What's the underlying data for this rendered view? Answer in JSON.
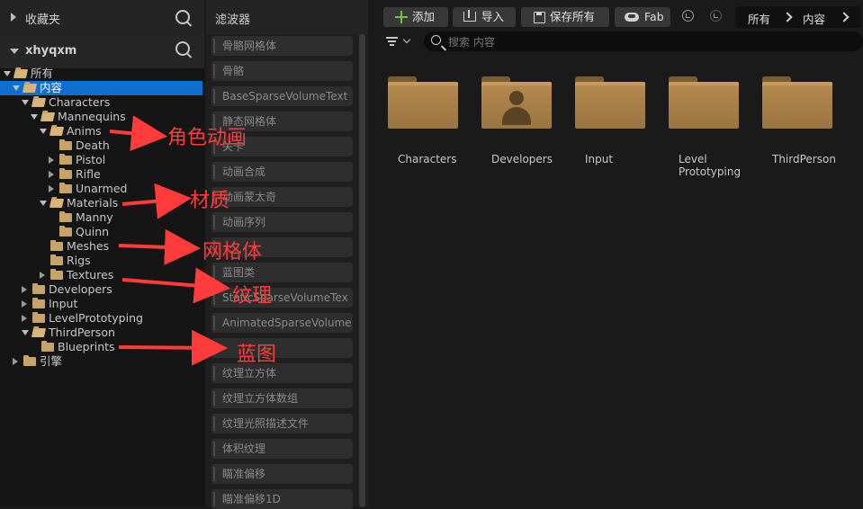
{
  "left_panel": {
    "favorites_label": "收藏夹",
    "project_label": "xhyqxm",
    "tree": [
      {
        "label": "所有",
        "depth": 0,
        "expander": "open",
        "folder": "open",
        "selected": false
      },
      {
        "label": "内容",
        "depth": 1,
        "expander": "open",
        "folder": "open",
        "selected": true
      },
      {
        "label": "Characters",
        "depth": 2,
        "expander": "open",
        "folder": "open",
        "selected": false
      },
      {
        "label": "Mannequins",
        "depth": 3,
        "expander": "open",
        "folder": "open",
        "selected": false
      },
      {
        "label": "Anims",
        "depth": 4,
        "expander": "open",
        "folder": "open",
        "selected": false
      },
      {
        "label": "Death",
        "depth": 5,
        "expander": "none",
        "folder": "closed",
        "selected": false
      },
      {
        "label": "Pistol",
        "depth": 5,
        "expander": "closed",
        "folder": "closed",
        "selected": false
      },
      {
        "label": "Rifle",
        "depth": 5,
        "expander": "closed",
        "folder": "closed",
        "selected": false
      },
      {
        "label": "Unarmed",
        "depth": 5,
        "expander": "closed",
        "folder": "closed",
        "selected": false
      },
      {
        "label": "Materials",
        "depth": 4,
        "expander": "open",
        "folder": "open",
        "selected": false
      },
      {
        "label": "Manny",
        "depth": 5,
        "expander": "none",
        "folder": "closed",
        "selected": false
      },
      {
        "label": "Quinn",
        "depth": 5,
        "expander": "none",
        "folder": "closed",
        "selected": false
      },
      {
        "label": "Meshes",
        "depth": 4,
        "expander": "none",
        "folder": "closed",
        "selected": false
      },
      {
        "label": "Rigs",
        "depth": 4,
        "expander": "none",
        "folder": "closed",
        "selected": false
      },
      {
        "label": "Textures",
        "depth": 4,
        "expander": "closed",
        "folder": "closed",
        "selected": false
      },
      {
        "label": "Developers",
        "depth": 2,
        "expander": "closed",
        "folder": "closed",
        "selected": false
      },
      {
        "label": "Input",
        "depth": 2,
        "expander": "closed",
        "folder": "closed",
        "selected": false
      },
      {
        "label": "LevelPrototyping",
        "depth": 2,
        "expander": "closed",
        "folder": "closed",
        "selected": false
      },
      {
        "label": "ThirdPerson",
        "depth": 2,
        "expander": "open",
        "folder": "open",
        "selected": false
      },
      {
        "label": "Blueprints",
        "depth": 3,
        "expander": "none",
        "folder": "closed",
        "selected": false
      },
      {
        "label": "引擎",
        "depth": 1,
        "expander": "closed",
        "folder": "closed",
        "selected": false
      }
    ]
  },
  "filter_panel": {
    "title": "滤波器",
    "items": [
      "骨骼网格体",
      "骨骼",
      "BaseSparseVolumeText",
      "静态网格体",
      "关卡",
      "动画合成",
      "动画蒙太奇",
      "动画序列",
      "",
      "蓝图类",
      "StaticSparseVolumeTex",
      "AnimatedSparseVolume",
      "",
      "纹理立方体",
      "纹理立方体数组",
      "纹理光照描述文件",
      "体积纹理",
      "瞄准偏移",
      "瞄准偏移1D"
    ]
  },
  "toolbar": {
    "add_label": "添加",
    "import_label": "导入",
    "save_all_label": "保存所有",
    "fab_label": "Fab",
    "breadcrumb": [
      "所有",
      "内容"
    ]
  },
  "search": {
    "placeholder": "搜索 内容"
  },
  "folders": [
    {
      "label": "Characters",
      "icon": "folder-icon"
    },
    {
      "label": "Developers",
      "icon": "developer-folder-icon"
    },
    {
      "label": "Input",
      "icon": "folder-icon"
    },
    {
      "label": "Level\nPrototyping",
      "icon": "folder-icon"
    },
    {
      "label": "ThirdPerson",
      "icon": "folder-icon"
    }
  ],
  "annotations": {
    "anims": "角色动画",
    "materials": "材质",
    "meshes": "网格体",
    "textures": "纹理",
    "blueprints": "蓝图"
  },
  "colors": {
    "selection": "#0f6fd0",
    "annotation": "#ff3b3b",
    "folder": "#b58a4f",
    "add_icon": "#6fc24a"
  }
}
